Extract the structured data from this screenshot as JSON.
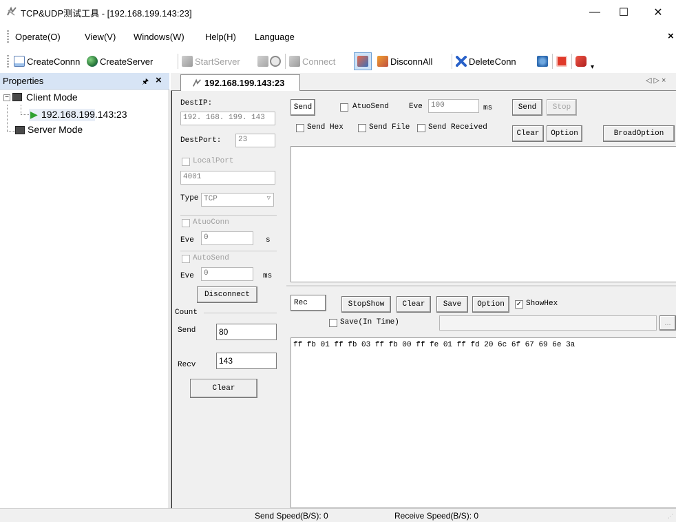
{
  "window": {
    "title": "TCP&UDP测试工具 - [192.168.199.143:23]",
    "minimize": "—",
    "maximize": "☐",
    "close": "✕"
  },
  "menu": {
    "items": [
      "Operate(O)",
      "View(V)",
      "Windows(W)",
      "Help(H)",
      "Language"
    ],
    "close": "×"
  },
  "toolbar": {
    "create_conn": "CreateConnn",
    "create_server": "CreateServer",
    "start_server": "StartServer",
    "connect": "Connect",
    "disconn_all": "DisconnAll",
    "delete_conn": "DeleteConn"
  },
  "properties": {
    "title": "Properties",
    "pin": "🖈",
    "close": "×",
    "tree": {
      "client_mode": "Client Mode",
      "client_conn": "192.168.199.143:23",
      "server_mode": "Server Mode"
    }
  },
  "tab": {
    "label": "192.168.199.143:23",
    "nav": "◁ ▷ ×"
  },
  "config": {
    "dest_ip_label": "DestIP:",
    "dest_ip_value": "192. 168. 199. 143",
    "dest_port_label": "DestPort:",
    "dest_port_value": "23",
    "local_port_label": "LocalPort",
    "local_port_value": "4001",
    "type_label": "Type",
    "type_value": "TCP",
    "atuo_conn_label": "AtuoConn",
    "eve_label": "Eve",
    "eve_conn_value": "0",
    "eve_conn_unit": "s",
    "auto_send_label": "AutoSend",
    "eve_send_value": "0",
    "eve_send_unit": "ms",
    "disconnect_button": "Disconnect",
    "count_label": "Count",
    "send_label": "Send",
    "send_count": "80",
    "recv_label": "Recv",
    "recv_count": "143",
    "clear_button": "Clear"
  },
  "send_panel": {
    "send_tag": "Send",
    "atuo_send_label": "AtuoSend",
    "eve_label": "Eve",
    "eve_value": "100",
    "eve_unit": "ms",
    "send_button": "Send",
    "stop_button": "Stop",
    "send_hex_label": "Send Hex",
    "send_file_label": "Send File",
    "send_received_label": "Send Received",
    "clear_button": "Clear",
    "option_button": "Option",
    "broad_option_button": "BroadOption",
    "content": ""
  },
  "recv_panel": {
    "rec_tag": "Rec",
    "stop_show_button": "StopShow",
    "clear_button": "Clear",
    "save_button": "Save",
    "option_button": "Option",
    "show_hex_label": "ShowHex",
    "show_hex_checked": true,
    "save_in_time_label": "Save(In Time)",
    "save_path_value": "",
    "browse_button": "...",
    "content": "ff fb 01 ff fb 03 ff fb 00 ff fe 01 ff fd 20 6c 6f 67 69 6e 3a"
  },
  "status": {
    "send_speed": "Send Speed(B/S): 0",
    "receive_speed": "Receive Speed(B/S): 0"
  },
  "colors": {
    "panel_header": "#d7e4f5",
    "form_bg": "#f0f0f0",
    "connected_arrow": "#2fa12f"
  }
}
